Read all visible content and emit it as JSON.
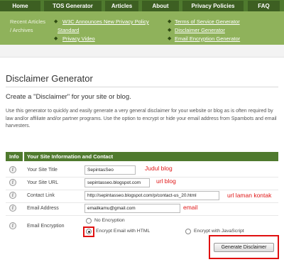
{
  "nav": {
    "tabs": [
      "Home",
      "TOS Generator",
      "Articles",
      "About",
      "Privacy Policies",
      "FAQ"
    ]
  },
  "recent": {
    "title_line1": "Recent Articles",
    "title_line2": "/ Archives",
    "links": [
      "W3C Announces New Privacy Policy",
      "Standard",
      "Privacy Video",
      "Terms of Service Generator",
      "Disclaimer Generator",
      "Email Encryption Generator"
    ]
  },
  "page": {
    "title": "Disclaimer Generator",
    "subtitle": "Create a \"Disclaimer\" for your site or blog.",
    "description": "Use this generator to quickly and easily generate a very general disclaimer for your website or blog as is often required by law and/or affiliate and/or partner programs. Use the option to encrypt or hide your email address from Spambots and email harvesters."
  },
  "form": {
    "header_info": "Info",
    "header_main": "Your Site Information and Contact",
    "site_title_label": "Your Site Title",
    "site_title_value": "SepintasSeo",
    "site_url_label": "Your Site URL",
    "site_url_value": "sepintasseo.blogspot.com",
    "contact_label": "Contact Link",
    "contact_value": "http://sepintasseo.blogspot.com/p/contact-us_20.html",
    "email_label": "Email Address",
    "email_value": "emailkamu@gmail.com",
    "encryption_label": "Email Encryption",
    "options": [
      "No Encryption",
      "Encrypt Email with HTML",
      "Encrypt with JavaScript"
    ],
    "selected_option": "Encrypt Email with HTML",
    "submit_label": "Generate Disclaimer"
  },
  "annotations": {
    "title_note": "Judul blog",
    "url_note": "url blog",
    "contact_note": "url laman kontak",
    "email_note": "email"
  },
  "colors": {
    "nav_bg": "#4f7a2e",
    "band_bg": "#8fb25b",
    "annotation": "#e01818"
  }
}
